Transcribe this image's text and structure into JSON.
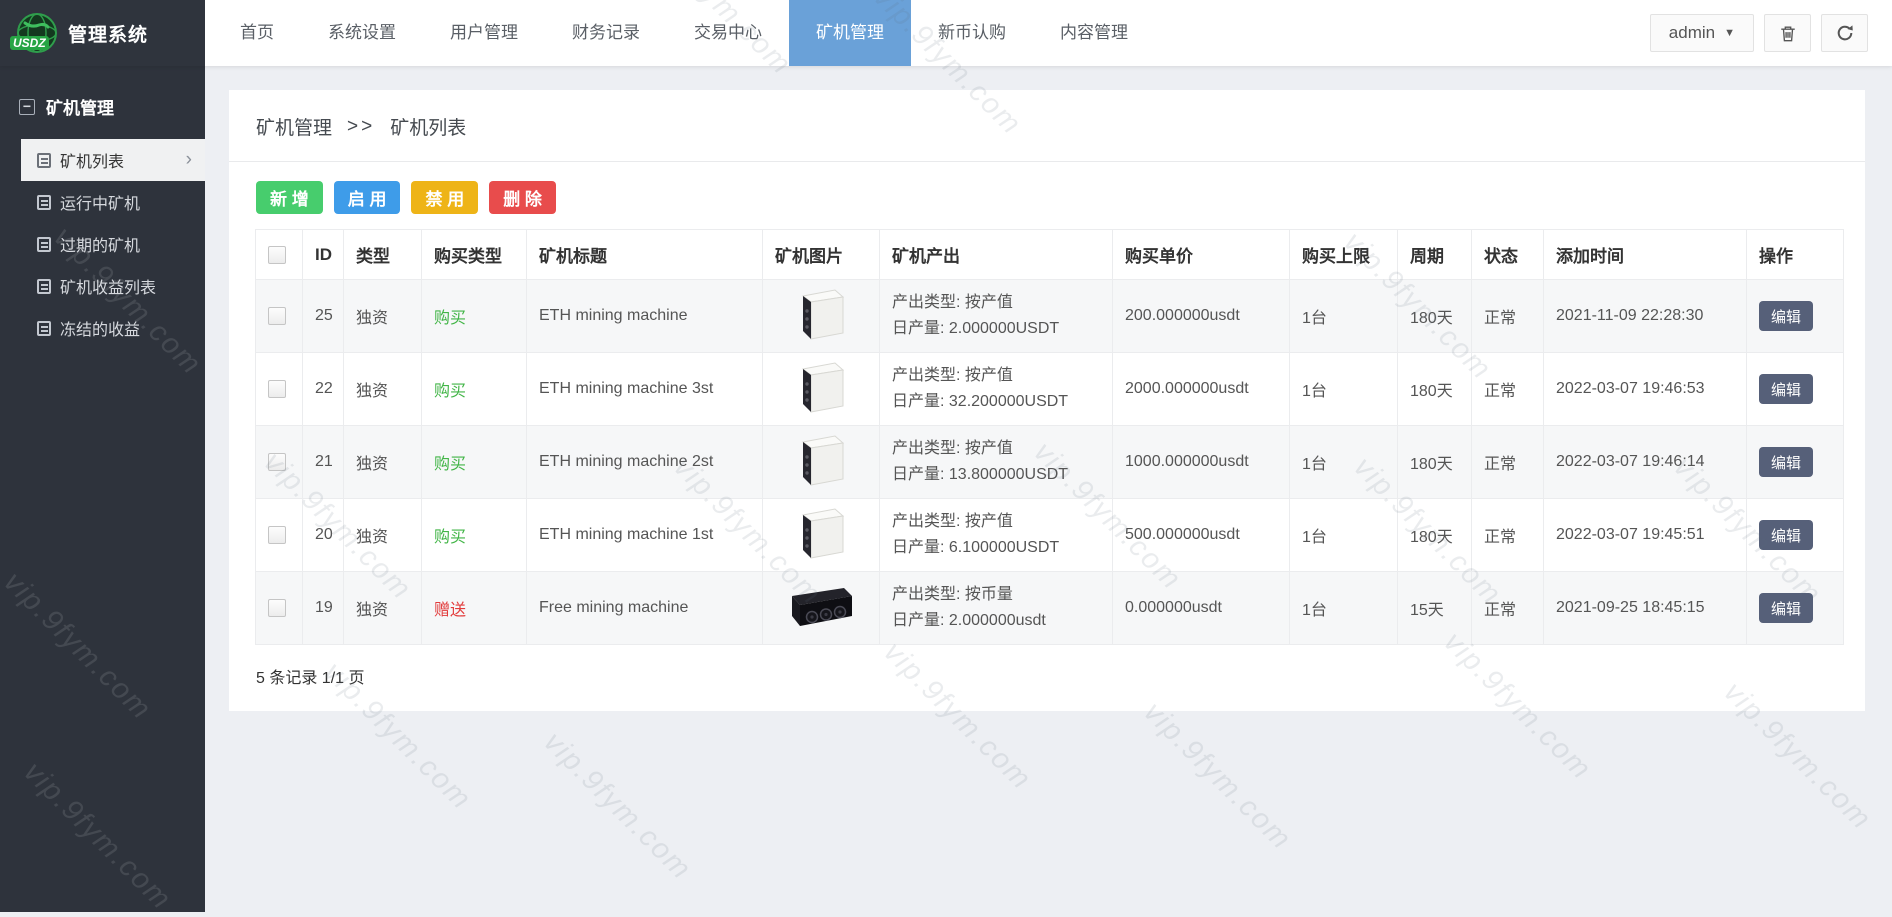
{
  "app": {
    "logo_text": "USDZ",
    "title": "管理系统"
  },
  "topnav": {
    "items": [
      "首页",
      "系统设置",
      "用户管理",
      "财务记录",
      "交易中心",
      "矿机管理",
      "新币认购",
      "内容管理"
    ],
    "active_index": 5
  },
  "user": {
    "name": "admin",
    "caret_icon": "▼"
  },
  "header_icons": {
    "trash": "trash-icon",
    "refresh": "refresh-icon"
  },
  "sidebar": {
    "section_label": "矿机管理",
    "collapse_glyph": "−",
    "items": [
      {
        "label": "矿机列表",
        "active": true
      },
      {
        "label": "运行中矿机",
        "active": false
      },
      {
        "label": "过期的矿机",
        "active": false
      },
      {
        "label": "矿机收益列表",
        "active": false
      },
      {
        "label": "冻结的收益",
        "active": false
      }
    ],
    "active_chevron": "›"
  },
  "breadcrumb": {
    "parent": "矿机管理",
    "separator": ">>",
    "current": "矿机列表"
  },
  "toolbar": {
    "buttons": [
      {
        "label": "新 增",
        "style": "green"
      },
      {
        "label": "启 用",
        "style": "blue"
      },
      {
        "label": "禁 用",
        "style": "yellow"
      },
      {
        "label": "删 除",
        "style": "red"
      }
    ]
  },
  "table": {
    "headers": [
      "ID",
      "类型",
      "购买类型",
      "矿机标题",
      "矿机图片",
      "矿机产出",
      "购买单价",
      "购买上限",
      "周期",
      "状态",
      "添加时间",
      "操作"
    ],
    "edit_label": "编辑",
    "rows": [
      {
        "id": "25",
        "type": "独资",
        "buy_type": "购买",
        "buy_style": "green",
        "title": "ETH mining machine",
        "image": "white-miner",
        "output_line1": "产出类型: 按产值",
        "output_line2": "日产量: 2.000000USDT",
        "price": "200.000000usdt",
        "limit": "1台",
        "period": "180天",
        "status": "正常",
        "time": "2021-11-09 22:28:30"
      },
      {
        "id": "22",
        "type": "独资",
        "buy_type": "购买",
        "buy_style": "green",
        "title": "ETH mining machine 3st",
        "image": "white-miner",
        "output_line1": "产出类型: 按产值",
        "output_line2": "日产量: 32.200000USDT",
        "price": "2000.000000usdt",
        "limit": "1台",
        "period": "180天",
        "status": "正常",
        "time": "2022-03-07 19:46:53"
      },
      {
        "id": "21",
        "type": "独资",
        "buy_type": "购买",
        "buy_style": "green",
        "title": "ETH mining machine 2st",
        "image": "white-miner",
        "output_line1": "产出类型: 按产值",
        "output_line2": "日产量: 13.800000USDT",
        "price": "1000.000000usdt",
        "limit": "1台",
        "period": "180天",
        "status": "正常",
        "time": "2022-03-07 19:46:14"
      },
      {
        "id": "20",
        "type": "独资",
        "buy_type": "购买",
        "buy_style": "green",
        "title": "ETH mining machine 1st",
        "image": "white-miner",
        "output_line1": "产出类型: 按产值",
        "output_line2": "日产量: 6.100000USDT",
        "price": "500.000000usdt",
        "limit": "1台",
        "period": "180天",
        "status": "正常",
        "time": "2022-03-07 19:45:51"
      },
      {
        "id": "19",
        "type": "独资",
        "buy_type": "赠送",
        "buy_style": "red",
        "title": "Free mining machine",
        "image": "black-miner",
        "output_line1": "产出类型: 按币量",
        "output_line2": "日产量: 2.000000usdt",
        "price": "0.000000usdt",
        "limit": "1台",
        "period": "15天",
        "status": "正常",
        "time": "2021-09-25 18:45:15"
      }
    ]
  },
  "footer": {
    "summary": "5 条记录 1/1 页"
  },
  "watermark": {
    "text": "vip.9fym.com"
  },
  "colors": {
    "accent_blue": "#6aa1d8",
    "sidebar_bg": "#2e333c",
    "btn_green": "#47cd6d",
    "btn_blue": "#3e9ce9",
    "btn_yellow": "#eeb417",
    "btn_red": "#e84c4c",
    "buy_green": "#42b547",
    "gift_red": "#e23b3b",
    "edit_btn": "#566079"
  }
}
